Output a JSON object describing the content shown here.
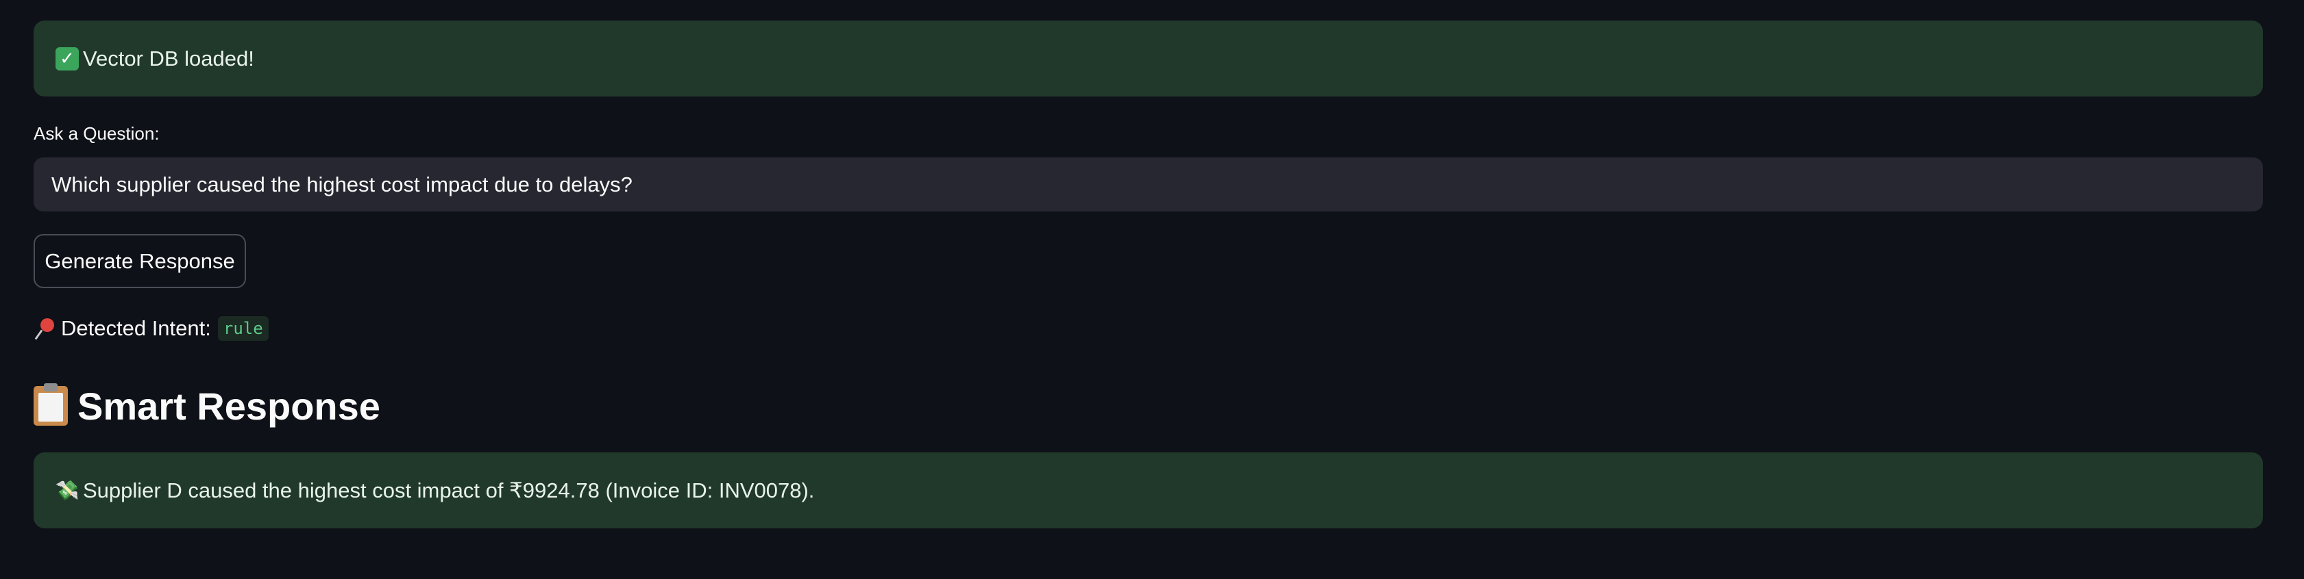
{
  "status": {
    "icon": "check-mark-icon",
    "text": "Vector DB loaded!"
  },
  "question": {
    "label": "Ask a Question:",
    "value": "Which supplier caused the highest cost impact due to delays?"
  },
  "generate_button": {
    "label": "Generate Response"
  },
  "intent": {
    "icon": "pushpin-icon",
    "label": "Detected Intent:",
    "value": "rule"
  },
  "response": {
    "heading_icon": "clipboard-icon",
    "heading": "Smart Response",
    "icon": "money-with-wings-icon",
    "text": "Supplier D caused the highest cost impact of ₹9924.78 (Invoice ID: INV0078)."
  },
  "colors": {
    "background": "#0e1117",
    "success_bg": "#21392b",
    "input_bg": "#262730",
    "code_text": "#5ec98a"
  }
}
